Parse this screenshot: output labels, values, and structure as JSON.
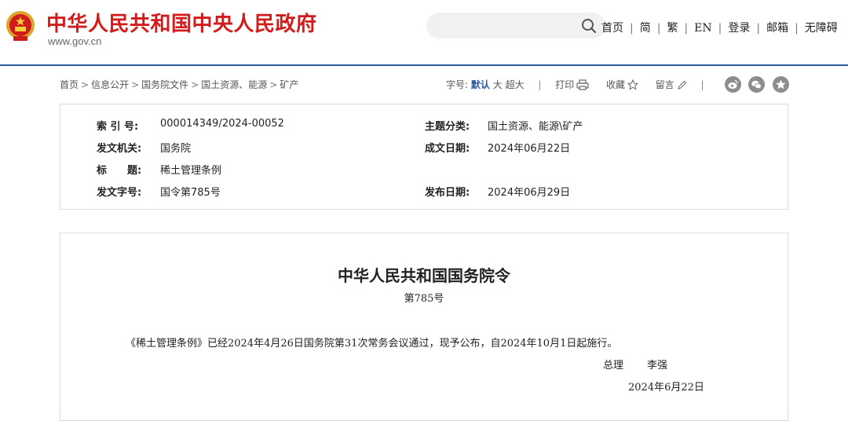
{
  "header": {
    "site_title": "中华人民共和国中央人民政府",
    "site_url": "www.gov.cn",
    "search_placeholder": "",
    "nav": [
      "首页",
      "简",
      "繁",
      "EN",
      "登录",
      "邮箱",
      "无障碍"
    ]
  },
  "breadcrumb": [
    "首页",
    "信息公开",
    "国务院文件",
    "国土资源、能源",
    "矿产"
  ],
  "tools": {
    "font_size_label": "字号:",
    "font_default": "默认",
    "font_large": "大",
    "font_xlarge": "超大",
    "print": "打印",
    "favorite": "收藏",
    "comment": "留言"
  },
  "share_icons": [
    "weibo-icon",
    "wechat-icon",
    "favorite-star-icon"
  ],
  "info": {
    "index_no_label": "索 引 号:",
    "index_no": "000014349/2024-00052",
    "category_label": "主题分类:",
    "category": "国土资源、能源\\矿产",
    "issuer_label": "发文机关:",
    "issuer": "国务院",
    "written_date_label": "成文日期:",
    "written_date": "2024年06月22日",
    "title_label": "标　　题:",
    "title": "稀土管理条例",
    "doc_no_label": "发文字号:",
    "doc_no": "国令第785号",
    "publish_date_label": "发布日期:",
    "publish_date": "2024年06月29日"
  },
  "article": {
    "title": "中华人民共和国国务院令",
    "decree_no": "第785号",
    "body": "《稀土管理条例》已经2024年4月26日国务院第31次常务会议通过，现予公布，自2024年10月1日起施行。",
    "signer_title": "总理",
    "signer_name": "李强",
    "sign_date": "2024年6月22日"
  },
  "colors": {
    "brand_red": "#d21c1c",
    "accent_blue": "#2a5a9e",
    "border": "#dcdcdc"
  }
}
